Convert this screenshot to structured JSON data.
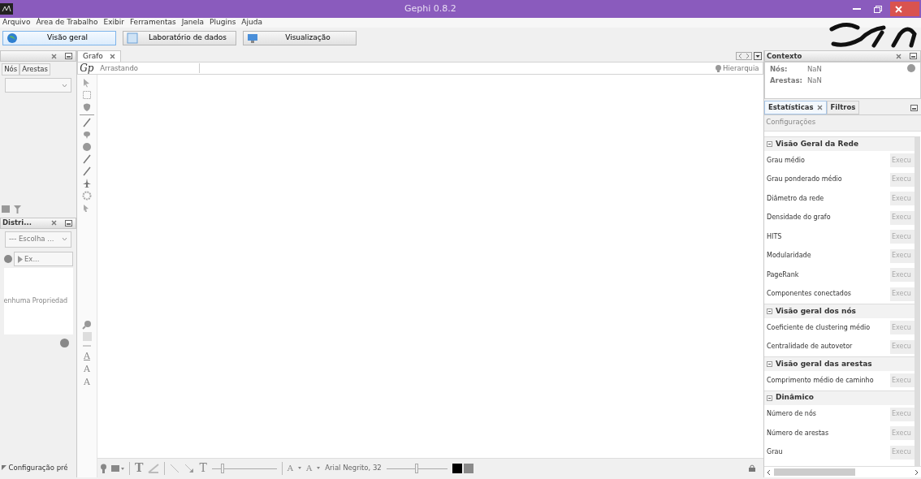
{
  "window": {
    "title": "Gephi 0.8.2"
  },
  "menu": [
    "Arquivo",
    "Área de Trabalho",
    "Exibir",
    "Ferramentas",
    "Janela",
    "Plugins",
    "Ajuda"
  ],
  "workspaces": [
    {
      "label": "Visão geral",
      "selected": true
    },
    {
      "label": "Laboratório de dados",
      "selected": false
    },
    {
      "label": "Visualização",
      "selected": false
    }
  ],
  "left_panel": {
    "tabs": [
      {
        "label": "Nós",
        "selected": false
      },
      {
        "label": "Arestas",
        "selected": false
      }
    ]
  },
  "distribution_panel": {
    "title": "Distri...",
    "select": "--- Escolha ...",
    "run_button": "Ex...",
    "message": "enhuma Propriedad"
  },
  "preset": "Configuração pré",
  "graph": {
    "tab": "Grafo",
    "logo": "Gp",
    "mode": "Arrastando",
    "hierarchy": "Hierarquia",
    "label_tools": [
      {
        "glyph": "A",
        "underlined": true
      },
      {
        "glyph": "A",
        "underlined": false
      },
      {
        "glyph": "A",
        "underlined": false
      }
    ]
  },
  "bottom_toolbar": {
    "text_tool": "T",
    "label_tool": "T",
    "size_slider": {
      "level": 0.15
    },
    "font_glyphs": [
      "A",
      "A"
    ],
    "font": "Arial Negrito, 32",
    "color_slider": {
      "level": 0.5
    },
    "swatches": [
      {
        "color": "#000000"
      },
      {
        "color": "#8a8a8a"
      }
    ]
  },
  "context": {
    "title": "Contexto",
    "rows": [
      {
        "label": "Nós:",
        "value": "NaN"
      },
      {
        "label": "Arestas:",
        "value": "NaN"
      }
    ]
  },
  "stats_tabs": [
    {
      "label": "Estatísticas",
      "selected": true
    },
    {
      "label": "Filtros",
      "selected": false
    }
  ],
  "settings": "Configurações",
  "sections": [
    {
      "title": "Visão Geral da Rede",
      "expanded": true,
      "items": [
        {
          "label": "Grau médio",
          "button": "Execu"
        },
        {
          "label": "Grau ponderado médio",
          "button": "Execu"
        },
        {
          "label": "Diâmetro da rede",
          "button": "Execu"
        },
        {
          "label": "Densidade do grafo",
          "button": "Execu"
        },
        {
          "label": "HITS",
          "button": "Execu"
        },
        {
          "label": "Modularidade",
          "button": "Execu"
        },
        {
          "label": "PageRank",
          "button": "Execu"
        },
        {
          "label": "Componentes conectados",
          "button": "Execu"
        }
      ]
    },
    {
      "title": "Visão geral dos nós",
      "expanded": true,
      "items": [
        {
          "label": "Coeficiente de clustering médio",
          "button": "Execu"
        },
        {
          "label": "Centralidade de autovetor",
          "button": "Execu"
        }
      ]
    },
    {
      "title": "Visão geral das arestas",
      "expanded": true,
      "items": [
        {
          "label": "Comprimento médio de caminho",
          "button": "Execu"
        }
      ]
    },
    {
      "title": "Dinâmico",
      "expanded": true,
      "items": [
        {
          "label": "Número de nós",
          "button": "Execu"
        },
        {
          "label": "Número de arestas",
          "button": "Execu"
        },
        {
          "label": "Grau",
          "button": "Execu"
        }
      ]
    }
  ]
}
